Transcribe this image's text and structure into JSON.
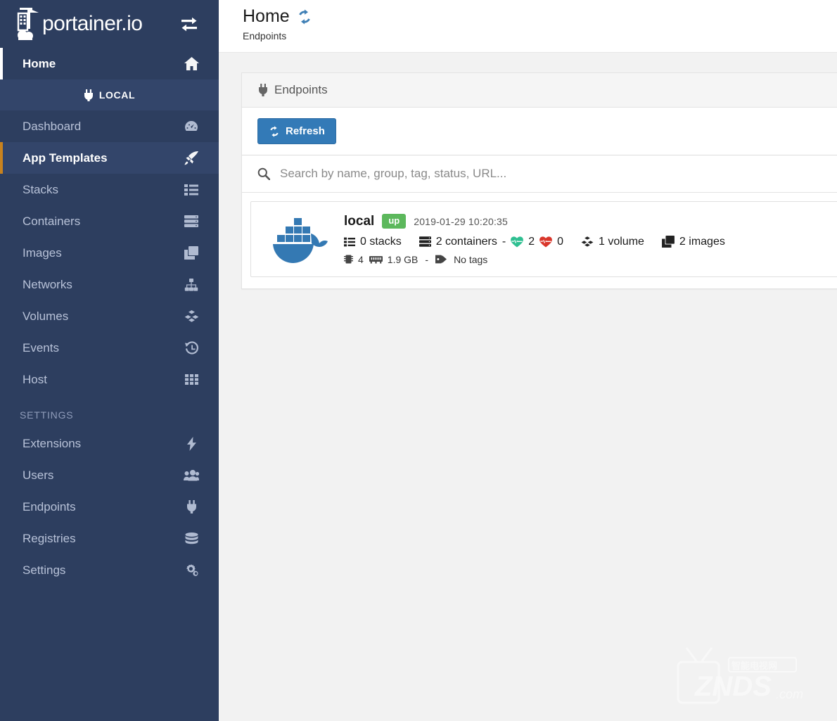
{
  "brand": {
    "name": "portainer.io",
    "toggle_icon": "exchange-arrows-icon"
  },
  "sidebar": {
    "home": {
      "label": "Home",
      "icon": "home-icon"
    },
    "environment": {
      "label": "LOCAL",
      "icon": "plug-icon"
    },
    "items": [
      {
        "label": "Dashboard",
        "icon": "tachometer-icon",
        "active": false
      },
      {
        "label": "App Templates",
        "icon": "rocket-icon",
        "active": true
      },
      {
        "label": "Stacks",
        "icon": "list-icon",
        "active": false
      },
      {
        "label": "Containers",
        "icon": "server-icon",
        "active": false
      },
      {
        "label": "Images",
        "icon": "clone-icon",
        "active": false
      },
      {
        "label": "Networks",
        "icon": "sitemap-icon",
        "active": false
      },
      {
        "label": "Volumes",
        "icon": "cubes-icon",
        "active": false
      },
      {
        "label": "Events",
        "icon": "history-icon",
        "active": false
      },
      {
        "label": "Host",
        "icon": "th-icon",
        "active": false
      }
    ],
    "settings_section": {
      "title": "SETTINGS"
    },
    "settings_items": [
      {
        "label": "Extensions",
        "icon": "bolt-icon"
      },
      {
        "label": "Users",
        "icon": "users-icon"
      },
      {
        "label": "Endpoints",
        "icon": "plug-icon"
      },
      {
        "label": "Registries",
        "icon": "database-icon"
      },
      {
        "label": "Settings",
        "icon": "cogs-icon"
      }
    ]
  },
  "header": {
    "title": "Home",
    "subtitle": "Endpoints",
    "refresh_icon": "refresh-icon"
  },
  "panel": {
    "title": "Endpoints",
    "title_icon": "plug-icon",
    "refresh_button": "Refresh",
    "refresh_button_icon": "refresh-icon",
    "search": {
      "placeholder": "Search by name, group, tag, status, URL...",
      "value": "",
      "icon": "search-icon"
    }
  },
  "endpoint": {
    "logo_icon": "docker-whale-icon",
    "name": "local",
    "status": "up",
    "status_color": "#5cb85c",
    "last_check": "2019-01-29 10:20:35",
    "stats": {
      "stacks": "0 stacks",
      "stacks_icon": "list-icon",
      "containers": "2 containers",
      "containers_icon": "server-icon",
      "separator": "-",
      "healthy_count": "2",
      "healthy_icon": "heartbeat-green-icon",
      "unhealthy_count": "0",
      "unhealthy_icon": "heartbeat-red-icon",
      "volumes": "1 volume",
      "volumes_icon": "cubes-icon",
      "images": "2 images",
      "images_icon": "clone-icon"
    },
    "resources": {
      "cpu": "4",
      "cpu_icon": "microchip-icon",
      "memory": "1.9 GB",
      "memory_icon": "memory-icon",
      "dash": "-",
      "tags": "No tags",
      "tags_icon": "tag-icon"
    }
  },
  "watermark": {
    "text": "ZNDS.com"
  },
  "colors": {
    "sidebar_bg": "#2d3e5f",
    "sidebar_active_bg": "#33456a",
    "accent_orange": "#c8821e",
    "primary_blue": "#337ab7",
    "status_green": "#5cb85c",
    "body_bg": "#f2f2f2"
  }
}
